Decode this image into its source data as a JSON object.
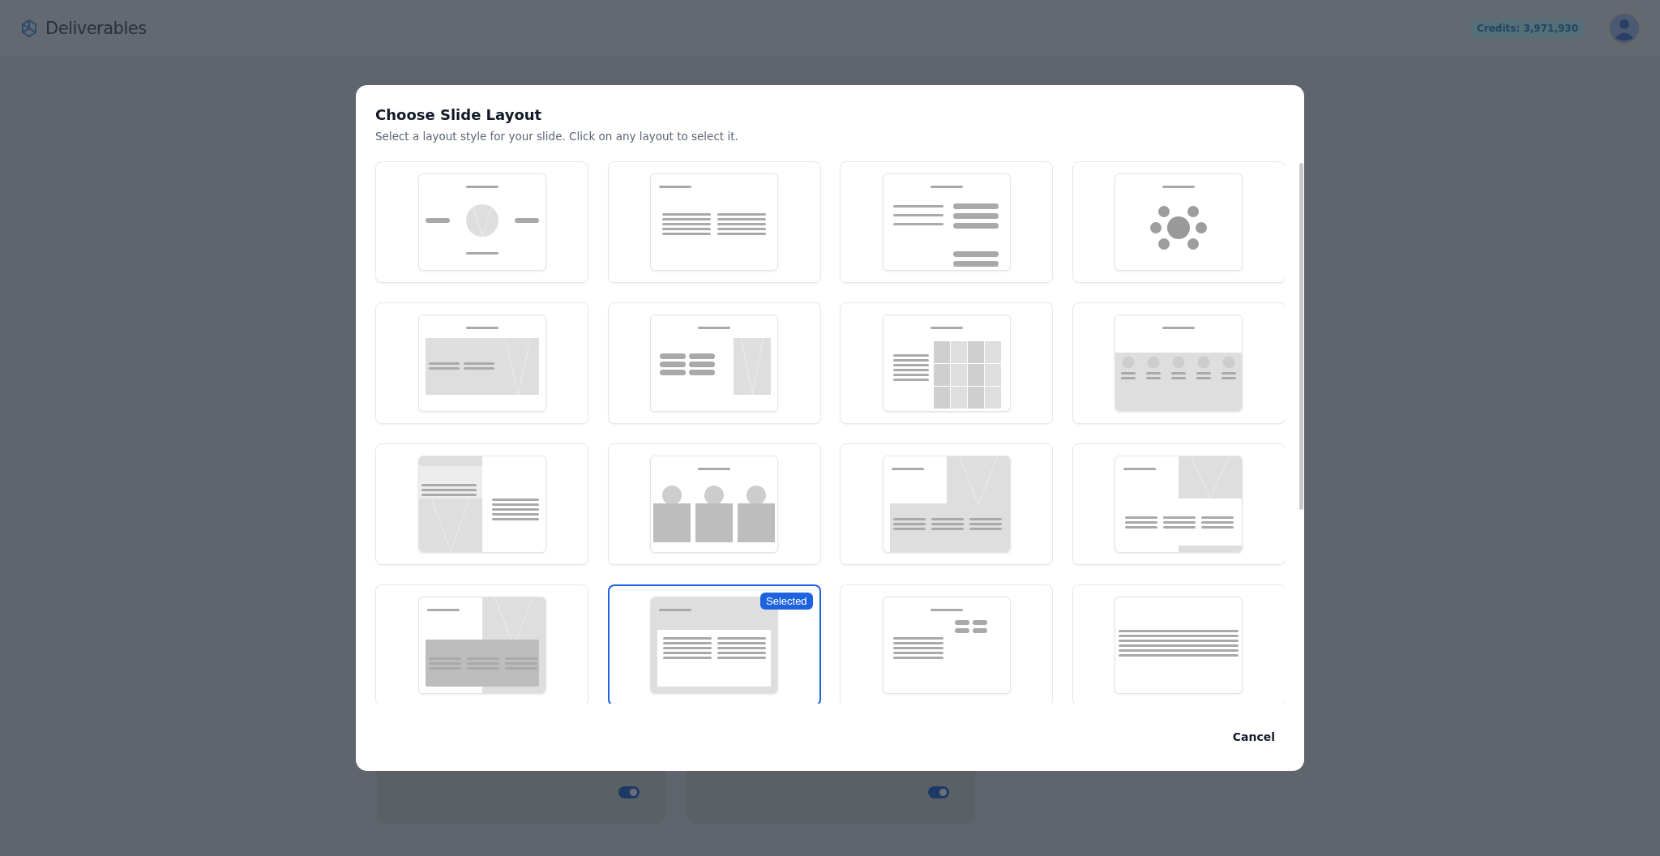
{
  "app": {
    "logo": "Deliverables",
    "credits": "Credits: 3,971,930"
  },
  "dialog": {
    "title": "Choose Slide Layout",
    "subtitle": "Select a layout style for your slide. Click on any layout to select it.",
    "selected_badge": "Selected",
    "cancel": "Cancel",
    "layouts": [
      {
        "kind": "hub",
        "selected": false
      },
      {
        "kind": "columns",
        "selected": false
      },
      {
        "kind": "mixed",
        "selected": false
      },
      {
        "kind": "radial",
        "selected": false
      },
      {
        "kind": "overlay",
        "selected": false
      },
      {
        "kind": "blocks",
        "selected": false
      },
      {
        "kind": "grid",
        "selected": false
      },
      {
        "kind": "band",
        "selected": false
      },
      {
        "kind": "split",
        "selected": false
      },
      {
        "kind": "team",
        "selected": false
      },
      {
        "kind": "corner",
        "selected": false
      },
      {
        "kind": "cornerlight",
        "selected": false
      },
      {
        "kind": "cornerdark",
        "selected": false
      },
      {
        "kind": "header",
        "selected": true
      },
      {
        "kind": "buttons",
        "selected": false
      },
      {
        "kind": "text",
        "selected": false
      }
    ]
  },
  "background_cards": [
    {
      "on": true
    },
    {
      "on": true
    }
  ]
}
